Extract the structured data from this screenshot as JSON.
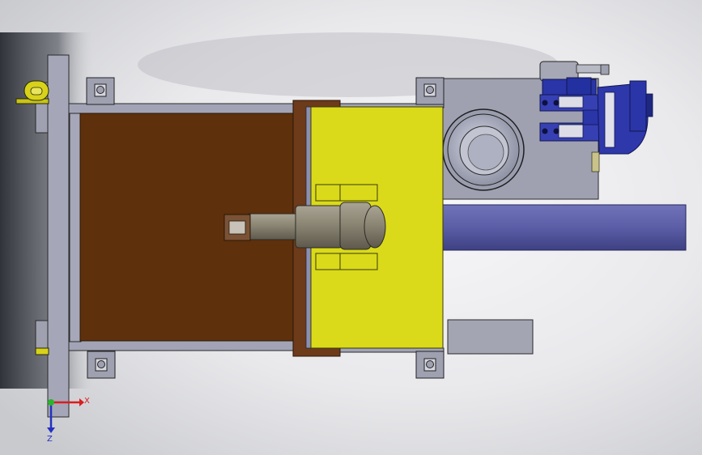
{
  "axes": {
    "x_label": "X",
    "z_label": "Z"
  },
  "colors": {
    "background_light": "#f2f2f4",
    "background_dark": "#3c4046",
    "frame_gray": "#9c9eae",
    "frame_outline": "#2a2a2a",
    "brown_tray": "#5e300c",
    "yellow_block": "#dada1a",
    "gold_flange": "#6d3a1a",
    "valve_blue": "#2a35a8",
    "cylinder_purple": "#5c5fa8",
    "shaft_gray": "#8c8676",
    "axis_x": "#d81e1e",
    "axis_z": "#2430c0",
    "axis_origin": "#2bb52b"
  }
}
